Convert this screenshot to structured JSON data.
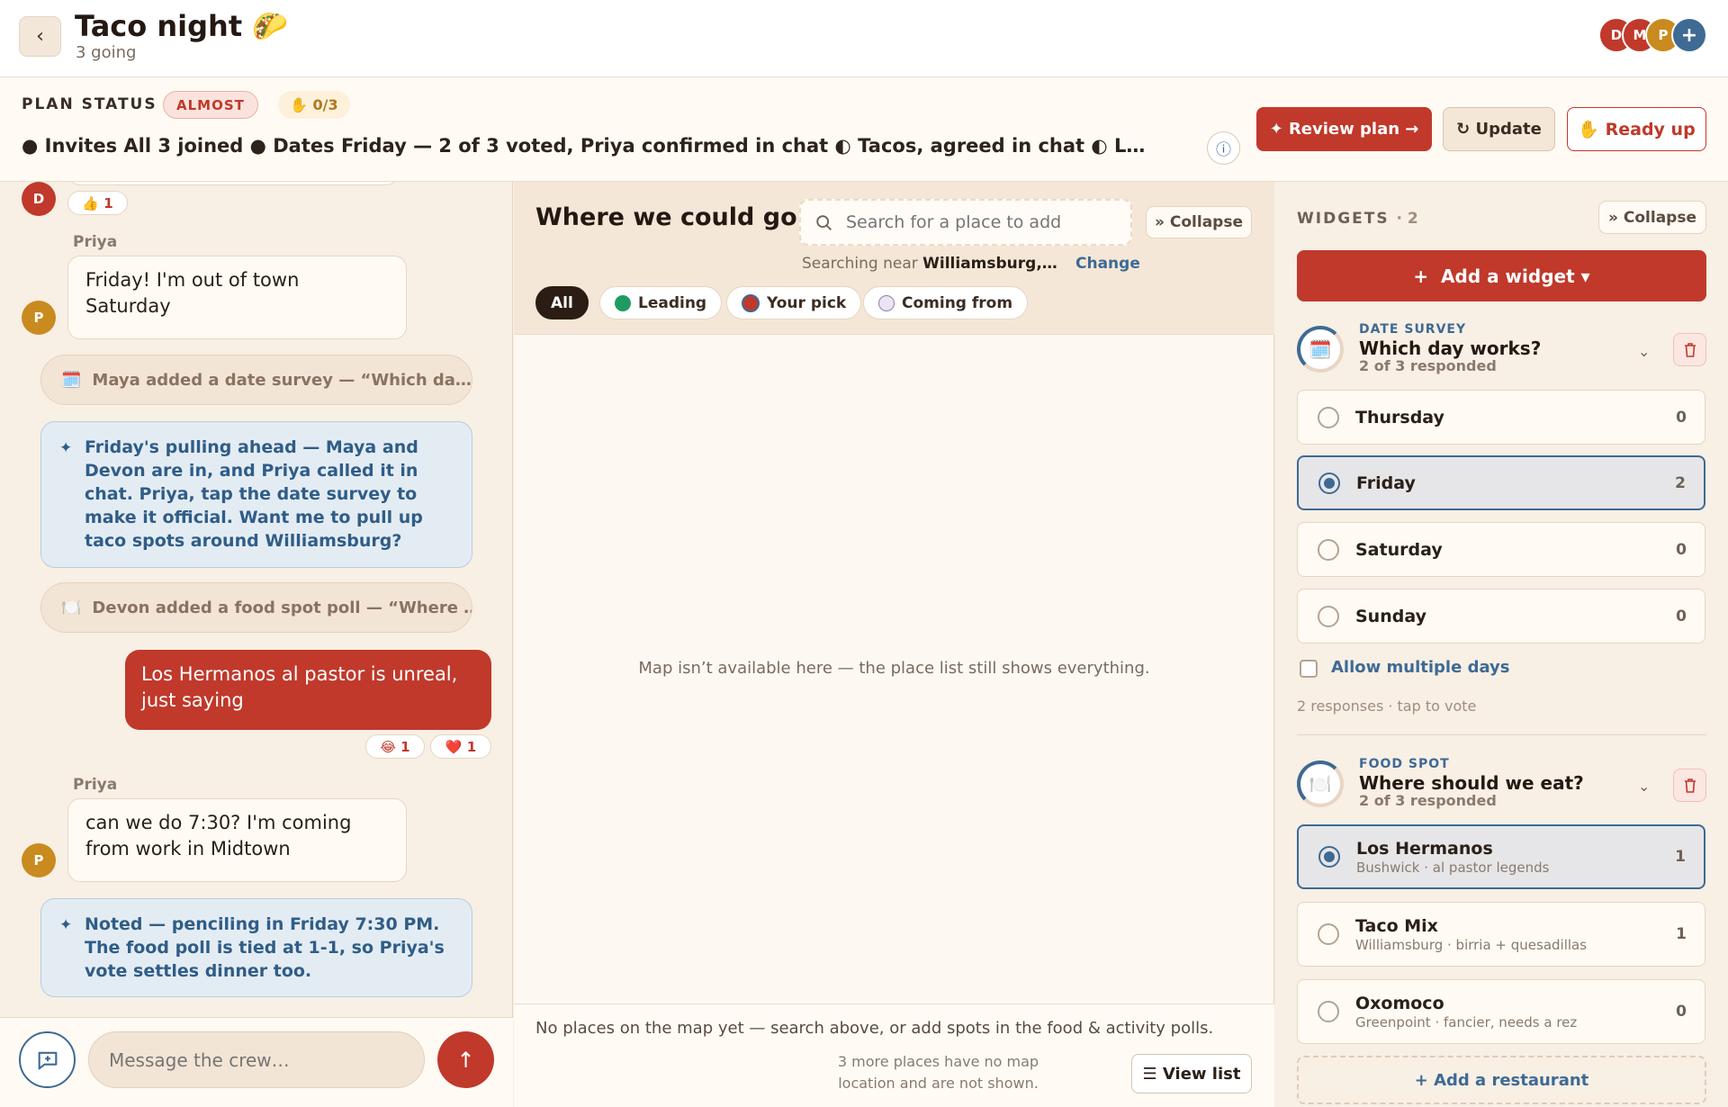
{
  "header": {
    "back_label": "‹",
    "title": "Taco night 🌮",
    "subtitle": "3 going",
    "avatars": [
      {
        "initial": "D",
        "color": "#c0392b"
      },
      {
        "initial": "M",
        "color": "#c0392b"
      },
      {
        "initial": "P",
        "color": "#c98b1f"
      }
    ],
    "add_member": "+"
  },
  "status": {
    "label": "PLAN STATUS",
    "badge": "ALMOST",
    "ready_count": "✋ 0/3",
    "line": "● Invites All 3 joined   ● Dates Friday — 2 of 3 voted, Priya confirmed in chat   ◐ Tacos, agreed in chat   ◐ L…",
    "info_icon": "ⓘ",
    "review_label": "✦ Review plan →",
    "update_label": "↻ Update",
    "readyup_label": "✋ Ready up"
  },
  "chat": {
    "top_avatar": "D",
    "top_reaction": "👍 1",
    "msg1_sender": "Priya",
    "msg1_text": "Friday! I'm out of town Saturday",
    "msg1_avatar": "P",
    "sys1_icon": "🗓️",
    "sys1_text": "Maya added a date survey — “Which da…",
    "sys_chevron": "›",
    "ai1_spark": "✦",
    "ai1_text": "Friday's pulling ahead — Maya and Devon are in, and Priya called it in chat. Priya, tap the date survey to make it official. Want me to pull up taco spots around Williamsburg?",
    "sys2_icon": "🍽️",
    "sys2_text": "Devon added a food spot poll — “Where …",
    "my_msg": "Los Hermanos al pastor is unreal, just saying",
    "react_laugh": "😂 1",
    "react_heart": "❤️ 1",
    "msg2_sender": "Priya",
    "msg2_text": "can we do 7:30? I'm coming from work in Midtown",
    "msg2_avatar": "P",
    "ai2_spark": "✦",
    "ai2_text": "Noted — penciling in Friday 7:30 PM. The food poll is tied at 1-1, so Priya's vote settles dinner too.",
    "composer_placeholder": "Message the crew…",
    "send_icon": "↑"
  },
  "map": {
    "title": "Where we could go",
    "search_placeholder": "Search for a place to add",
    "collapse_label": "» Collapse",
    "near_prefix": "Searching near ",
    "near_place": "Williamsburg,…",
    "change_label": "Change",
    "filters": [
      "All",
      "Leading",
      "Your pick",
      "Coming from"
    ],
    "unavailable": "Map isn’t available here — the place list still shows everything.",
    "no_places": "No places on the map yet — search above, or add spots in the food & activity polls.",
    "more_places": "3 more places have no map location and are not shown.",
    "view_list": "☰ View list"
  },
  "widgets": {
    "label": "WIDGETS",
    "count": "· 2",
    "collapse_label": "» Collapse",
    "add_widget": "+  Add a widget ▾",
    "date_survey": {
      "type": "DATE SURVEY",
      "title": "Which day works?",
      "sub": "2 of 3 responded",
      "icon": "🗓️",
      "options": [
        {
          "name": "Thursday",
          "count": "0",
          "selected": false
        },
        {
          "name": "Friday",
          "count": "2",
          "selected": true
        },
        {
          "name": "Saturday",
          "count": "0",
          "selected": false
        },
        {
          "name": "Sunday",
          "count": "0",
          "selected": false
        }
      ],
      "multi_label": "Allow multiple days",
      "footer": "2 responses · tap to vote"
    },
    "food_spot": {
      "type": "FOOD SPOT",
      "title": "Where should we eat?",
      "sub": "2 of 3 responded",
      "icon": "🍽️",
      "options": [
        {
          "name": "Los Hermanos",
          "sub": "Bushwick · al pastor legends",
          "count": "1",
          "selected": true
        },
        {
          "name": "Taco Mix",
          "sub": "Williamsburg · birria + quesadillas",
          "count": "1",
          "selected": false
        },
        {
          "name": "Oxomoco",
          "sub": "Greenpoint · fancier, needs a rez",
          "count": "0",
          "selected": false
        }
      ],
      "add_label": "+ Add a restaurant"
    }
  },
  "colors": {
    "accent": "#c0392b",
    "blue": "#3e6a94",
    "background": "#f8efe5",
    "leading": "#1f9b62",
    "gold": "#c98b1f"
  }
}
